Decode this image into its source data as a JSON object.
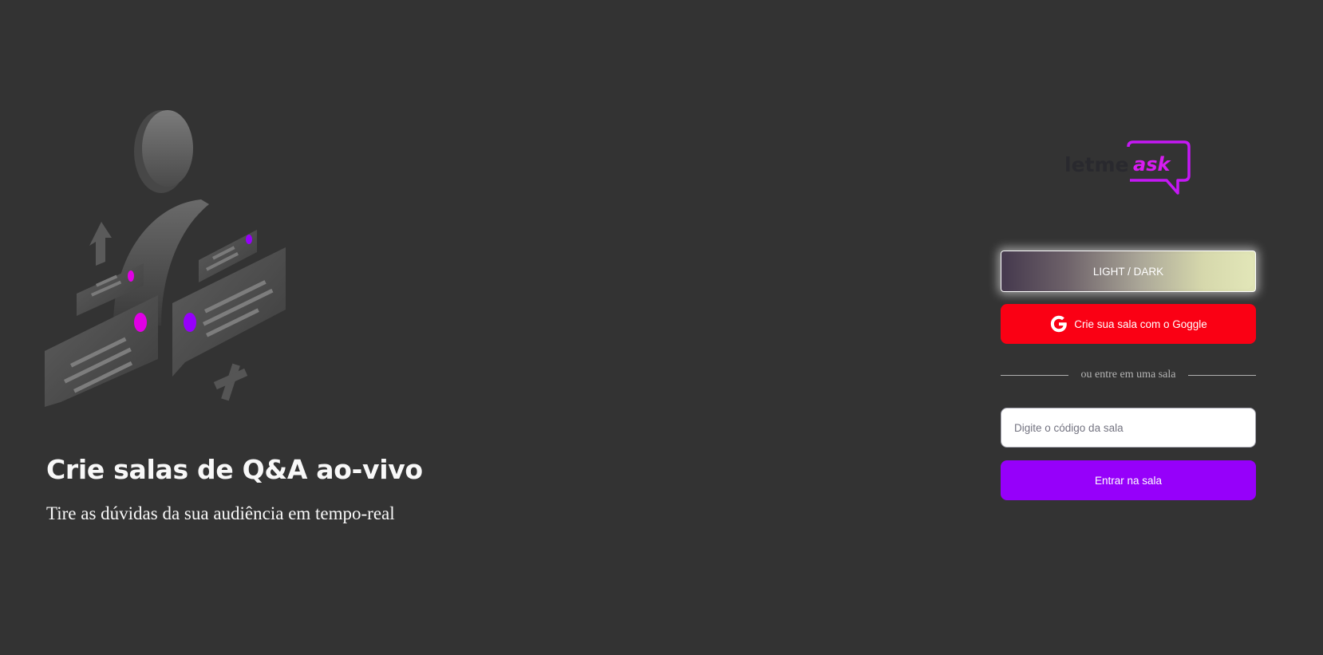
{
  "aside": {
    "title": "Crie salas de Q&A ao-vivo",
    "subtitle": "Tire as dúvidas da sua audiência em tempo-real",
    "illustration": "q-and-a-illustration"
  },
  "main": {
    "logo": {
      "part1": "letme",
      "part2": "ask",
      "icon": "speech-bubble-logo-icon"
    },
    "theme_toggle": {
      "label": "LIGHT / DARK"
    },
    "google_button": {
      "label": "Crie sua sala com o Goggle",
      "icon": "google-icon"
    },
    "separator": {
      "label": "ou entre em uma sala"
    },
    "room_code": {
      "value": "",
      "placeholder": "Digite o código da sala"
    },
    "enter_button": {
      "label": "Entrar na sala"
    }
  },
  "colors": {
    "background": "#333333",
    "google_red": "#fa0014",
    "accent_purple": "#9600fa",
    "logo_magenta": "#e559f9",
    "text_light": "#f8f8f8"
  }
}
